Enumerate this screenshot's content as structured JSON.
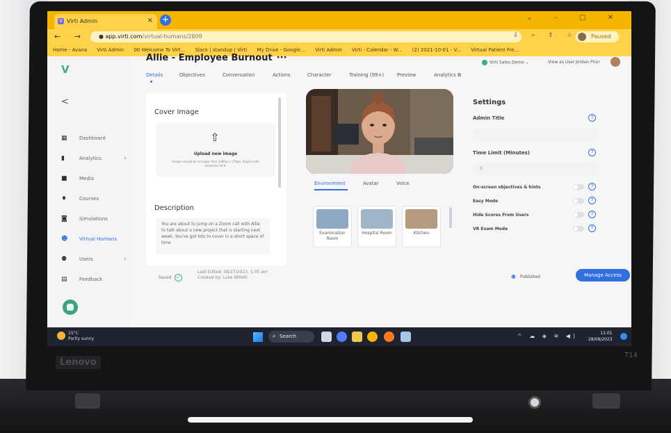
{
  "device": {
    "brand": "Lenovo",
    "model": "T14"
  },
  "browser": {
    "tab_title": "Virti Admin",
    "url_host": "app.virti.com",
    "url_path": "/virtual-humans/2809",
    "profile_status": "Paused",
    "bookmarks": [
      "Home - Avana",
      "Virti Admin",
      "00 Welcome To Virt...",
      "Slack | standup | Virti",
      "My Drive - Google...",
      "Virti Admin",
      "Virti - Calendar - W...",
      "(2) 2021-10-01 - V...",
      "Virtual Patient Fre..."
    ]
  },
  "topbar": {
    "environment": "Virti Sales Demo",
    "view_as": "View as User",
    "user_name": "Jordan Prior"
  },
  "sidebar": {
    "logo": "V",
    "collapse": "<",
    "items": [
      {
        "label": "Dashboard",
        "icon": "dashboard-icon"
      },
      {
        "label": "Analytics",
        "icon": "analytics-icon"
      },
      {
        "label": "Media",
        "icon": "media-icon"
      },
      {
        "label": "Courses",
        "icon": "courses-icon"
      },
      {
        "label": "Simulations",
        "icon": "simulations-icon"
      },
      {
        "label": "Virtual Humans",
        "icon": "virtual-humans-icon"
      },
      {
        "label": "Users",
        "icon": "users-icon"
      },
      {
        "label": "Feedback",
        "icon": "feedback-icon"
      }
    ]
  },
  "page": {
    "title": "Allie - Employee Burnout",
    "more": "···",
    "tabs": [
      "Details",
      "Objectives",
      "Conversation",
      "Actions",
      "Character",
      "Training (99+)",
      "Preview",
      "Analytics"
    ]
  },
  "cover": {
    "title": "Cover Image",
    "upload_label": "Upload new image",
    "upload_hint": "Images should be no larger than 1280px x 720px. Aspect ratio should be 16:9."
  },
  "description": {
    "title": "Description",
    "text": "You are about to jump on a Zoom call with Allie to talk about a new project that is starting next week. You've got lots to cover in a short space of time"
  },
  "media_tabs": [
    "Environment",
    "Avatar",
    "Voice"
  ],
  "environments": [
    {
      "label": "Examination Room",
      "color": "#8fa9c4"
    },
    {
      "label": "Hospital Room",
      "color": "#9fb6c8"
    },
    {
      "label": "Kitchen",
      "color": "#b59a7e"
    }
  ],
  "settings": {
    "title": "Settings",
    "admin_title_label": "Admin Title",
    "time_limit_label": "Time Limit (Minutes)",
    "time_limit_value": "0",
    "toggles": [
      "On-screen objectives & hints",
      "Easy Mode",
      "Hide Scores From Users",
      "VR Exam Mode"
    ]
  },
  "footer": {
    "saved": "Saved",
    "last_edited": "Last Edited: 08/27/2023, 1:05 am",
    "created_by": "Created by: Luke Willett",
    "published": "Published",
    "manage_access": "Manage Access"
  },
  "taskbar": {
    "temp": "15°C",
    "weather": "Partly sunny",
    "search": "Search",
    "time": "11:01",
    "date": "28/08/2023"
  },
  "colors": {
    "accent": "#2f6fe0",
    "brand_green": "#37b08a",
    "chrome_yellow": "#f5b400"
  }
}
